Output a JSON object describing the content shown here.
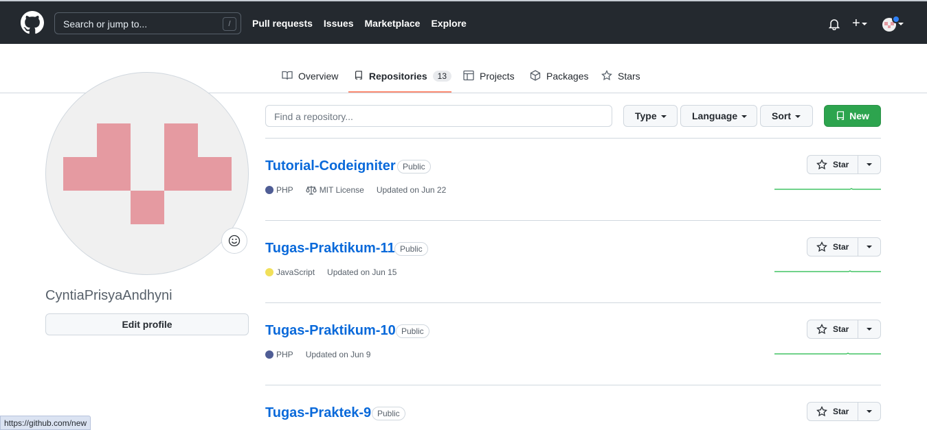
{
  "topbar": {
    "search_placeholder": "Search or jump to...",
    "search_shortcut": "/",
    "nav": [
      "Pull requests",
      "Issues",
      "Marketplace",
      "Explore"
    ],
    "plus_label": "+"
  },
  "tabs": [
    {
      "label": "Overview",
      "icon": "book-icon"
    },
    {
      "label": "Repositories",
      "icon": "repo-icon",
      "count": "13",
      "active": true
    },
    {
      "label": "Projects",
      "icon": "table-icon"
    },
    {
      "label": "Packages",
      "icon": "package-icon"
    },
    {
      "label": "Stars",
      "icon": "star-icon"
    }
  ],
  "profile": {
    "username": "CyntiaPrisyaAndhyni",
    "edit_label": "Edit profile",
    "identicon_color": "#e59aa1"
  },
  "filters": {
    "find_placeholder": "Find a repository...",
    "type_label": "Type",
    "language_label": "Language",
    "sort_label": "Sort",
    "new_label": "New"
  },
  "repos": [
    {
      "name": "Tutorial-Codeigniter",
      "visibility": "Public",
      "language": "PHP",
      "language_color": "#4f5d95",
      "license": "MIT License",
      "updated": "Updated on Jun 22",
      "star_label": "Star"
    },
    {
      "name": "Tugas-Praktikum-11",
      "visibility": "Public",
      "language": "JavaScript",
      "language_color": "#f1e05a",
      "updated": "Updated on Jun 15",
      "star_label": "Star"
    },
    {
      "name": "Tugas-Praktikum-10",
      "visibility": "Public",
      "language": "PHP",
      "language_color": "#4f5d95",
      "updated": "Updated on Jun 9",
      "star_label": "Star"
    },
    {
      "name": "Tugas-Praktek-9",
      "visibility": "Public",
      "star_label": "Star"
    }
  ],
  "status_bar": {
    "url": "https://github.com/new"
  }
}
